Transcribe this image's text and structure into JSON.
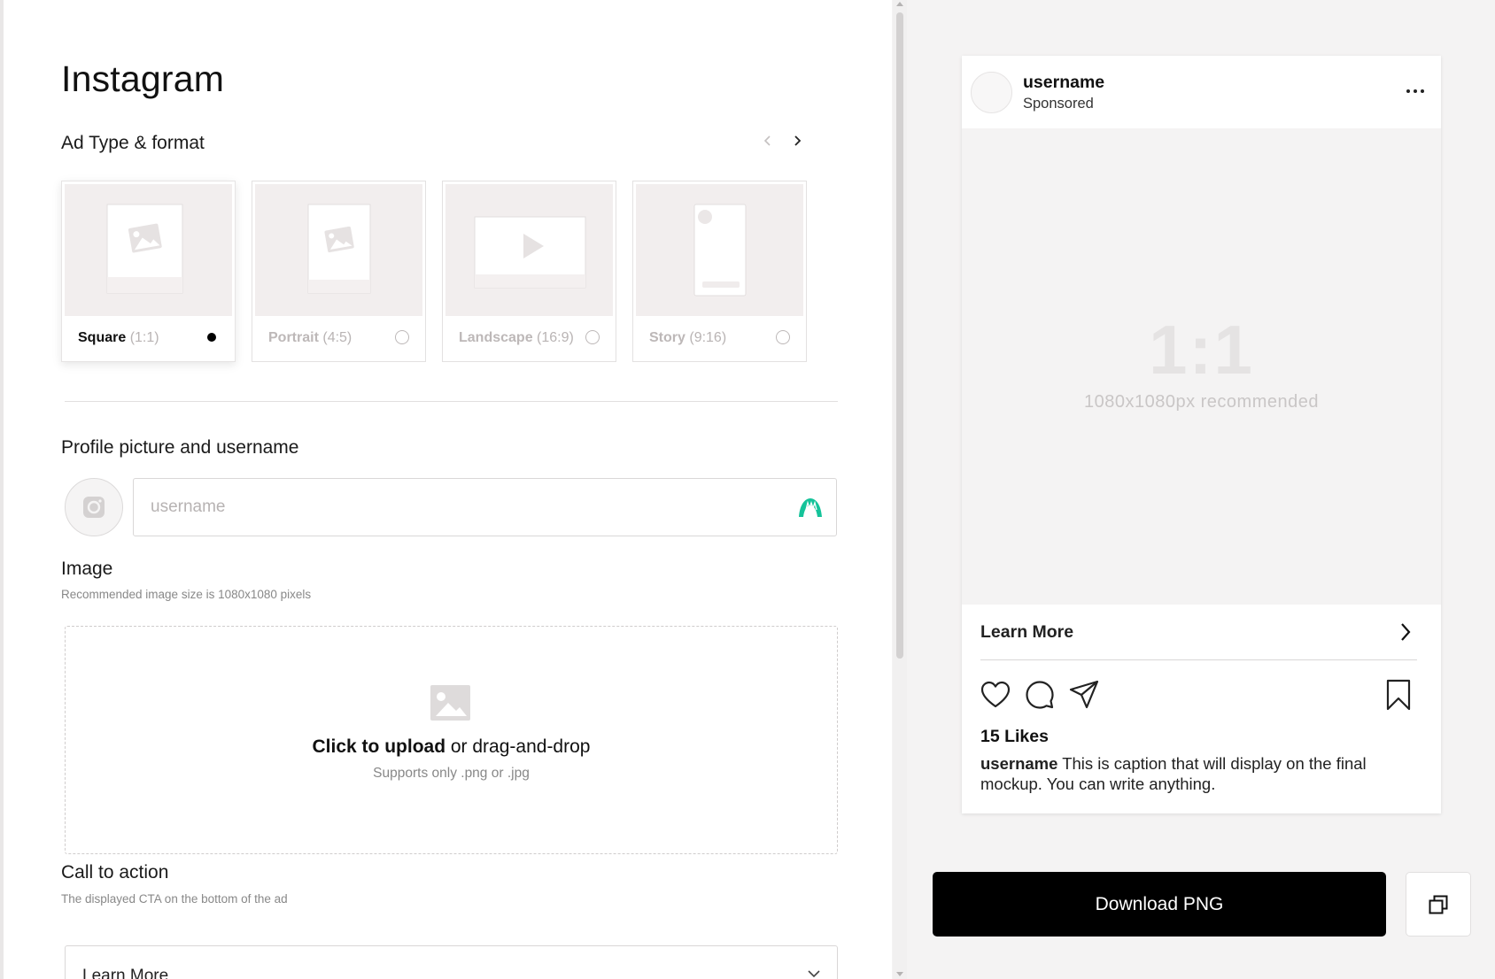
{
  "editor": {
    "title": "Instagram",
    "ad_type": {
      "heading": "Ad Type & format",
      "formats": [
        {
          "name": "Square",
          "ratio": "(1:1)",
          "selected": true
        },
        {
          "name": "Portrait",
          "ratio": "(4:5)",
          "selected": false
        },
        {
          "name": "Landscape",
          "ratio": "(16:9)",
          "selected": false
        },
        {
          "name": "Story",
          "ratio": "(9:16)",
          "selected": false
        }
      ]
    },
    "profile": {
      "heading": "Profile picture and username",
      "username_placeholder": "username",
      "username_value": ""
    },
    "image": {
      "heading": "Image",
      "subheading": "Recommended image size is 1080x1080 pixels",
      "upload_bold": "Click to upload",
      "upload_rest": "or drag-and-drop",
      "upload_hint": "Supports only .png or .jpg"
    },
    "cta": {
      "heading": "Call to action",
      "subheading": "The displayed CTA on the bottom of the ad",
      "selected": "Learn More"
    }
  },
  "preview": {
    "username": "username",
    "sponsored": "Sponsored",
    "aspect_ratio": "1:1",
    "recommended": "1080x1080px recommended",
    "cta_label": "Learn More",
    "likes": "15 Likes",
    "caption_username": "username",
    "caption_text": "This is caption that will display on the final mockup. You can write anything."
  },
  "actions": {
    "download_label": "Download PNG"
  },
  "icons": [
    "chevron-left-icon",
    "chevron-right-icon",
    "image-placeholder-icon",
    "play-icon",
    "camera-icon",
    "grammarly-icon",
    "more-icon",
    "heart-icon",
    "comment-icon",
    "share-icon",
    "bookmark-icon",
    "copy-icon"
  ],
  "colors": {
    "accent_button": "#000000",
    "panel_bg": "#f4f3f3",
    "grammar_icon": "#15c39a"
  }
}
